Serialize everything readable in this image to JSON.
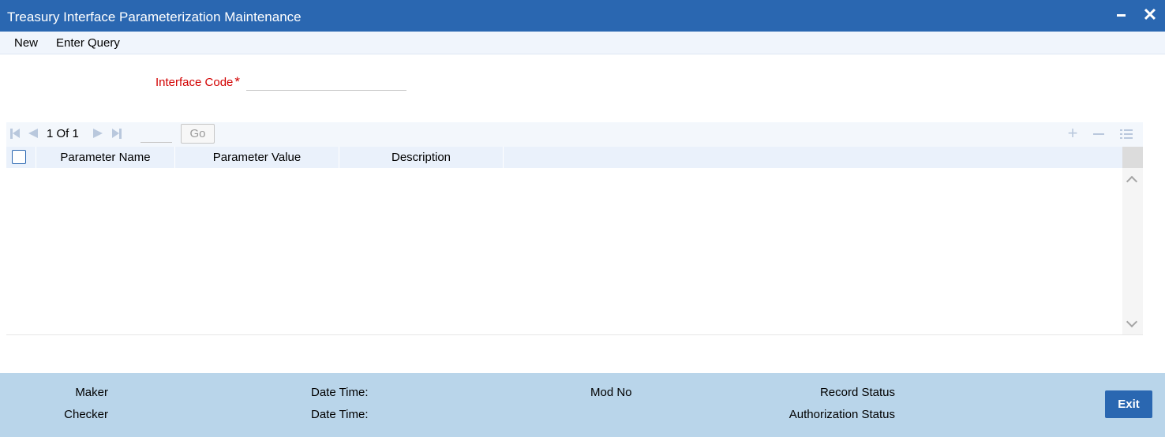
{
  "window": {
    "title": "Treasury Interface Parameterization Maintenance",
    "minimize_icon": "minimize-icon",
    "close_icon": "close-icon",
    "close_glyph": "✕"
  },
  "menu": {
    "items": [
      "New",
      "Enter Query"
    ]
  },
  "form": {
    "interface_code_label": "Interface Code",
    "required_marker": "*",
    "interface_code_value": ""
  },
  "grid": {
    "pagination": {
      "current": "1",
      "of_label": "Of",
      "total": "1",
      "page_input": "",
      "go_label": "Go"
    },
    "toolbar_icons": [
      "first-page-icon",
      "prev-page-icon",
      "next-page-icon",
      "last-page-icon",
      "add-row-icon",
      "delete-row-icon",
      "single-view-icon"
    ],
    "plus_glyph": "+",
    "columns": [
      "Parameter Name",
      "Parameter Value",
      "Description"
    ],
    "rows": []
  },
  "footer": {
    "maker_label": "Maker",
    "checker_label": "Checker",
    "date_time_label_1": "Date Time:",
    "date_time_label_2": "Date Time:",
    "mod_no_label": "Mod No",
    "record_status_label": "Record Status",
    "authorization_status_label": "Authorization Status",
    "exit_label": "Exit"
  },
  "colors": {
    "title_bar": "#2a67b1",
    "required_label": "#d20000",
    "footer": "#b9d5ea",
    "exit_button": "#2a67b1"
  }
}
